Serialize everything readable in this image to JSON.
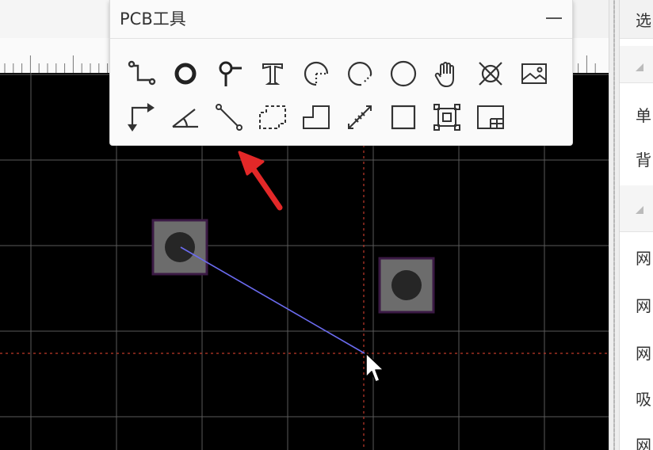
{
  "palette": {
    "title": "PCB工具",
    "tools_row1": [
      {
        "name": "wire-tool-icon"
      },
      {
        "name": "pad-tool-icon"
      },
      {
        "name": "via-tool-icon"
      },
      {
        "name": "text-tool-icon"
      },
      {
        "name": "arc-center-tool-icon"
      },
      {
        "name": "arc-tool-icon"
      },
      {
        "name": "circle-tool-icon"
      },
      {
        "name": "pan-hand-icon"
      },
      {
        "name": "no-connect-icon"
      },
      {
        "name": "image-tool-icon"
      }
    ],
    "tools_row2": [
      {
        "name": "dimension-tool-icon"
      },
      {
        "name": "angle-tool-icon"
      },
      {
        "name": "line-tool-icon"
      },
      {
        "name": "dashed-region-tool-icon"
      },
      {
        "name": "solid-region-tool-icon"
      },
      {
        "name": "measure-tool-icon"
      },
      {
        "name": "rectangle-tool-icon"
      },
      {
        "name": "copper-area-tool-icon"
      },
      {
        "name": "table-tool-icon"
      }
    ]
  },
  "right_panel": {
    "header": "选",
    "rows": [
      "单",
      "背",
      "网",
      "网",
      "网",
      "吸",
      "网"
    ]
  },
  "colors": {
    "canvas_bg": "#000000",
    "grid": "#5a5a5a",
    "crosshair": "#c0392b",
    "track": "#6b6bf0",
    "pad_fill": "#6c6c6c",
    "pad_border": "#3b1a45",
    "arrow": "#e32828"
  }
}
